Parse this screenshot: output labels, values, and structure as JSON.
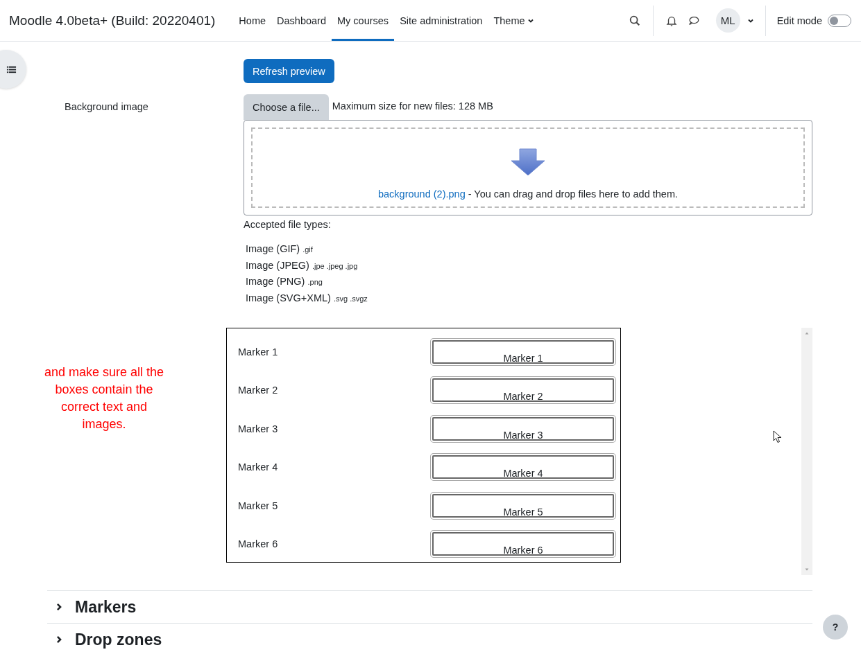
{
  "site_name": "Moodle 4.0beta+ (Build: 20220401)",
  "nav": [
    {
      "label": "Home",
      "selected": false,
      "dropdown": false
    },
    {
      "label": "Dashboard",
      "selected": false,
      "dropdown": false
    },
    {
      "label": "My courses",
      "selected": true,
      "dropdown": false
    },
    {
      "label": "Site administration",
      "selected": false,
      "dropdown": false
    },
    {
      "label": "Theme",
      "selected": false,
      "dropdown": true
    }
  ],
  "user": {
    "initials": "ML"
  },
  "edit_mode": {
    "label": "Edit mode",
    "on": false
  },
  "form": {
    "refresh_button": "Refresh preview",
    "background_image": {
      "label": "Background image",
      "choose_button": "Choose a file...",
      "max_size": "Maximum size for new files: 128 MB",
      "file_name": "background (2).png",
      "drop_hint": "- You can drag and drop files here to add them.",
      "accepted_label": "Accepted file types:",
      "types": [
        {
          "name": "Image (GIF)",
          "ext": ".gif"
        },
        {
          "name": "Image (JPEG)",
          "ext": ".jpe .jpeg .jpg"
        },
        {
          "name": "Image (PNG)",
          "ext": ".png"
        },
        {
          "name": "Image (SVG+XML)",
          "ext": ".svg .svgz"
        }
      ]
    }
  },
  "preview": {
    "note": "and make sure all the boxes contain the correct text and images.",
    "rows": [
      {
        "label": "Marker 1",
        "box": "Marker 1"
      },
      {
        "label": "Marker 2",
        "box": "Marker 2"
      },
      {
        "label": "Marker 3",
        "box": "Marker 3"
      },
      {
        "label": "Marker 4",
        "box": "Marker 4"
      },
      {
        "label": "Marker 5",
        "box": "Marker 5"
      },
      {
        "label": "Marker 6",
        "box": "Marker 6"
      }
    ]
  },
  "sections": [
    {
      "title": "Markers",
      "expanded": false
    },
    {
      "title": "Drop zones",
      "expanded": false
    }
  ],
  "help_button": "?"
}
